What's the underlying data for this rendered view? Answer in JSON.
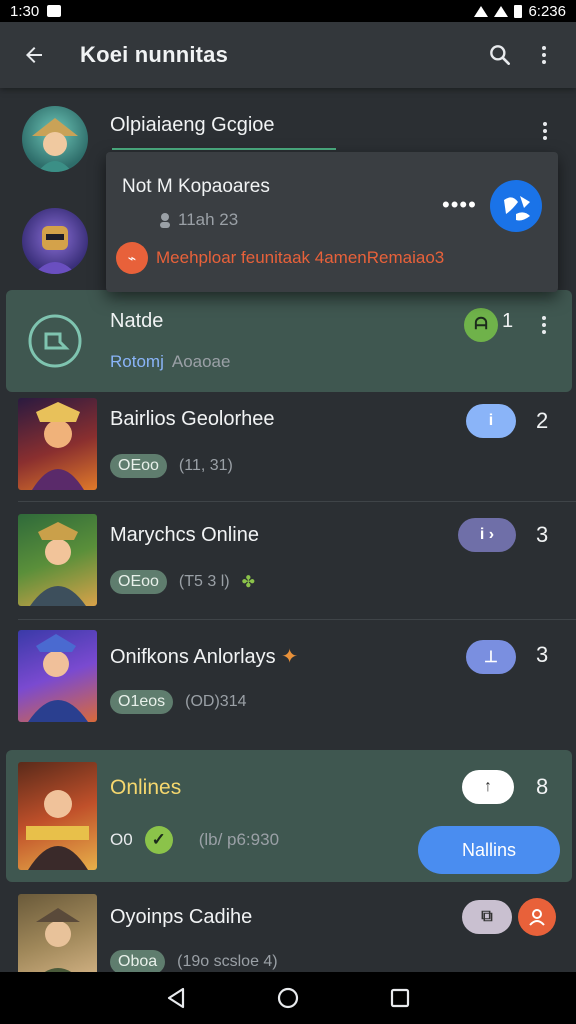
{
  "status": {
    "time": "1:30",
    "right_text": "6:236"
  },
  "app_bar": {
    "title": "Koei nunnitas"
  },
  "colors": {
    "accent_green": "#4caf82",
    "selected_bg": "#3f5750",
    "blue": "#4a8df0",
    "orange": "#e8613a"
  },
  "items": [
    {
      "title": "Olpiaiaeng Gcgioe"
    },
    {
      "title": ""
    },
    {
      "title": "Natde",
      "subtitle": "Rotomj",
      "subtitle2": "Aoaoae",
      "badge": "ᗩ",
      "count": "1"
    },
    {
      "title": "Bairlios Geolorhee",
      "pill": "OEoo",
      "meta": "(11, 31)",
      "badge": "i",
      "count": "2"
    },
    {
      "title": "Marychcs Online",
      "pill": "OEoo",
      "meta": "(T5 3 l)",
      "badge": "i ›",
      "count": "3"
    },
    {
      "title": "Onifkons Anlorlays",
      "pill": "O1eos",
      "meta": "(OD)314",
      "badge": "⊥",
      "count": "3"
    },
    {
      "title": "Onlines",
      "pill_plain": "O0",
      "meta": "(lb/ p6:930",
      "badge": "↑",
      "count": "8",
      "action_label": "Nallins"
    },
    {
      "title": "Oyoinps Cadihe",
      "pill": "Oboa",
      "meta": "(19o scsloe 4)",
      "badge": "⧉"
    }
  ],
  "popup": {
    "title": "Not M Kopaoares",
    "time": "11ah 23",
    "dots": "••••",
    "link": "Meehploar feunitaak 4amenRemaiao3"
  }
}
